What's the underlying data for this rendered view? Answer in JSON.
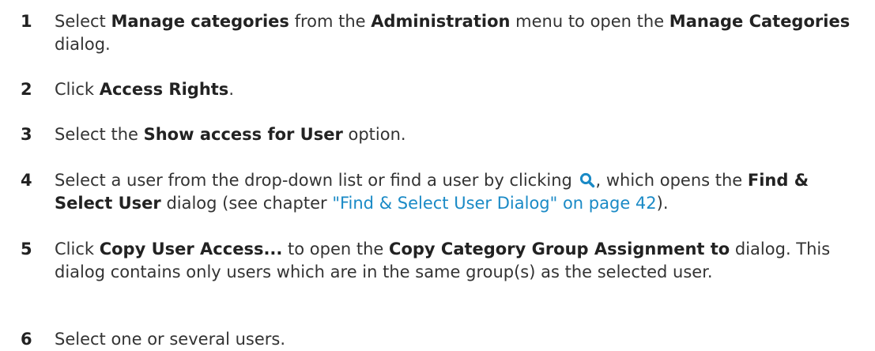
{
  "steps": [
    {
      "number": "1",
      "t1": "Select ",
      "b1": "Manage categories",
      "t2": " from the ",
      "b2": "Administration",
      "t3": " menu to open the ",
      "b3": "Manage Categories",
      "t4": " dialog."
    },
    {
      "number": "2",
      "t1": "Click ",
      "b1": "Access Rights",
      "t2": "."
    },
    {
      "number": "3",
      "t1": "Select the ",
      "b1": "Show access for User",
      "t2": " option."
    },
    {
      "number": "4",
      "t1": "Select a user from the drop-down list or find a user by clicking ",
      "icon": "search-icon",
      "t2": ", which opens the ",
      "b1": "Find & Select User",
      "t3": " dialog (see chapter ",
      "link": "\"Find & Select User Dialog\" on page 42",
      "t4": ")."
    },
    {
      "number": "5",
      "t1": "Click ",
      "b1": "Copy User Access...",
      "t2": " to open the ",
      "b2": "Copy Category Group Assignment to",
      "t3": " dialog. This dialog contains only users which are in the same group(s) as the selected user."
    },
    {
      "number": "6",
      "t1": "Select one or several users."
    }
  ],
  "colors": {
    "text": "#333333",
    "link": "#1a8ac6",
    "icon": "#1a8ac6"
  }
}
